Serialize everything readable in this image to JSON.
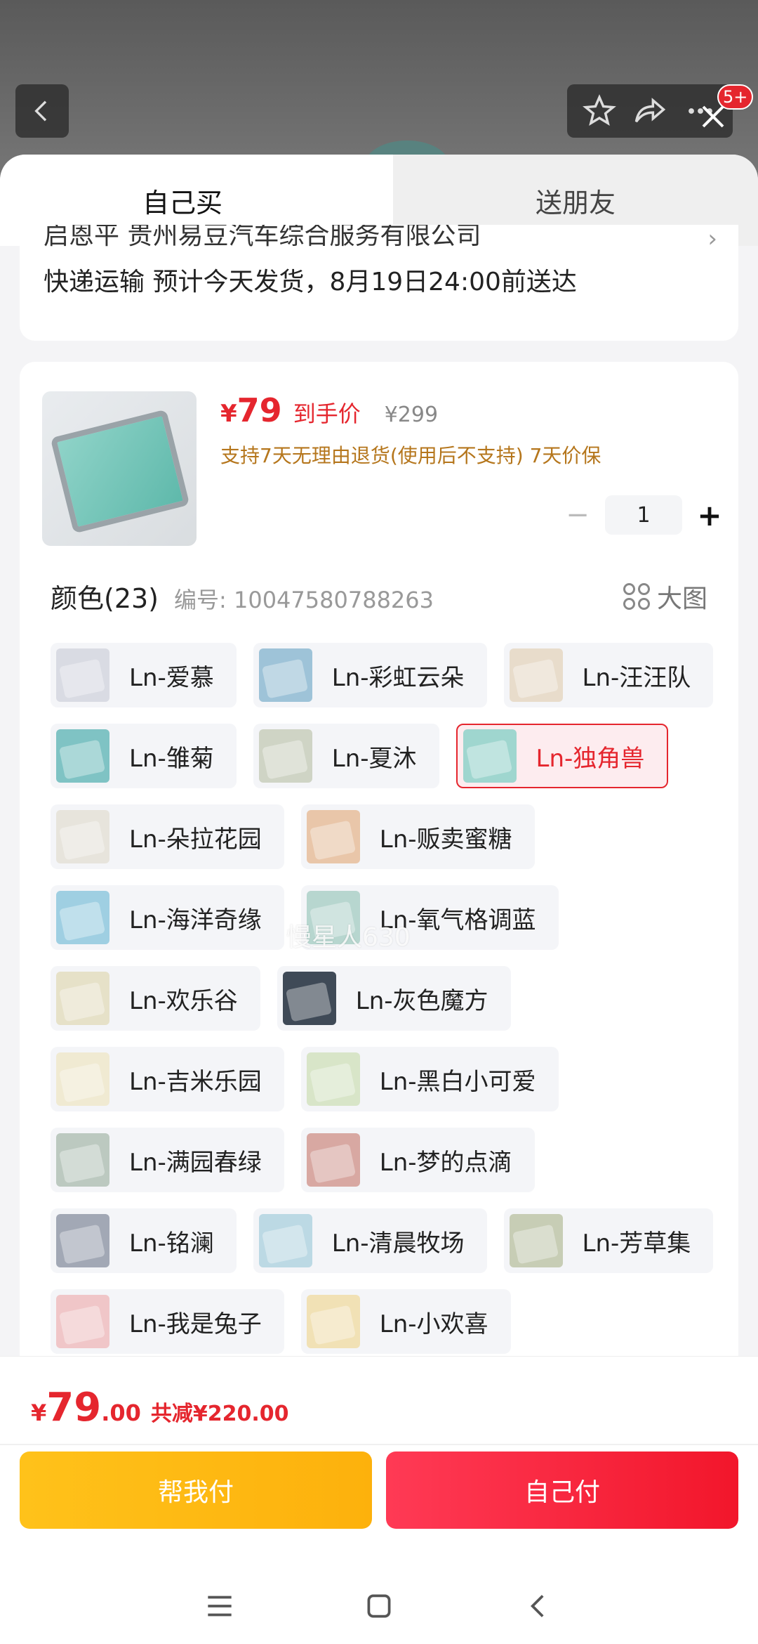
{
  "header": {
    "badge": "5+"
  },
  "tabs": {
    "self": "自己买",
    "friend": "送朋友"
  },
  "address": {
    "partial_line": "启恩平 贵州易豆汽车综合服务有限公司",
    "shipping": "快递运输 预计今天发货，8月19日24:00前送达"
  },
  "product": {
    "price_symbol": "¥",
    "price": "79",
    "price_tag": "到手价",
    "original_price": "¥299",
    "policy": "支持7天无理由退货(使用后不支持) 7天价保",
    "quantity": "1"
  },
  "color_section": {
    "title": "颜色(23)",
    "code": "编号: 10047580788263",
    "big_view": "大图"
  },
  "variants": [
    [
      "Ln-爱慕",
      "Ln-彩虹云朵",
      "Ln-汪汪队"
    ],
    [
      "Ln-雏菊",
      "Ln-夏沐",
      "Ln-独角兽"
    ],
    [
      "Ln-朵拉花园",
      "Ln-贩卖蜜糖"
    ],
    [
      "Ln-海洋奇缘",
      "Ln-氧气格调蓝"
    ],
    [
      "Ln-欢乐谷",
      "Ln-灰色魔方"
    ],
    [
      "Ln-吉米乐园",
      "Ln-黑白小可爱"
    ],
    [
      "Ln-满园春绿",
      "Ln-梦的点滴"
    ],
    [
      "Ln-铭澜",
      "Ln-清晨牧场",
      "Ln-芳草集"
    ],
    [
      "Ln-我是兔子",
      "Ln-小欢喜"
    ]
  ],
  "selected_variant": "Ln-独角兽",
  "watermark": "慢星人630",
  "footer": {
    "price_symbol": "¥",
    "price_int": "79",
    "price_dec": ".00",
    "discount": "共减¥220.00",
    "help_pay": "帮我付",
    "self_pay": "自己付"
  },
  "colors": {
    "accent_red": "#e5262e",
    "help_yellow": "#fdb10c",
    "policy_gold": "#b5761c"
  }
}
